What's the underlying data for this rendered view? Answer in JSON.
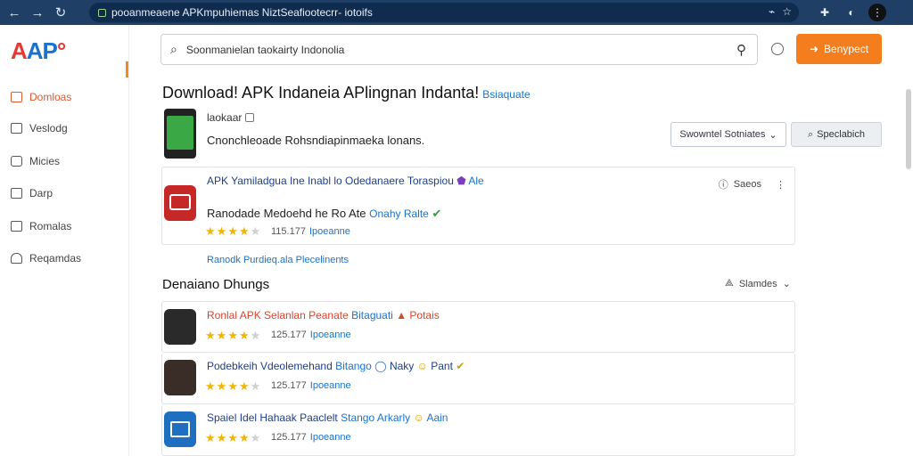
{
  "browser": {
    "url": "pooanmeaene APKmpuhiemas NiztSeafiootecrr- iotoifs"
  },
  "logo": {
    "part1": "A",
    "part2": "AP",
    "mark": "°"
  },
  "sidebar": {
    "items": [
      {
        "label": "Domloas",
        "active": true,
        "icon": "download-icon"
      },
      {
        "label": "Veslodg",
        "active": false,
        "icon": "square-icon"
      },
      {
        "label": "Micies",
        "active": false,
        "icon": "info-icon"
      },
      {
        "label": "Darp",
        "active": false,
        "icon": "box-icon"
      },
      {
        "label": "Romalas",
        "active": false,
        "icon": "grid-icon"
      },
      {
        "label": "Reqamdas",
        "active": false,
        "icon": "home-icon"
      }
    ]
  },
  "search": {
    "placeholder": "Soonmanielan taokairty Indonolia"
  },
  "header_button": {
    "label": "Benypect"
  },
  "page": {
    "title": "Download! APK Indaneia APlingnan Indanta!",
    "subtitle": "Bsiaquate",
    "meta_small": "laokaar",
    "meta_desc": "Cnonchleoade Rohsndiapinmaeka lonans.",
    "dropdown_label": "Swowntel Sotniates",
    "spec_button": "Speclabich"
  },
  "featured": {
    "title": "APK Yamiladgua Ine Inabl lo Odedanaere Toraspiou",
    "title_badge": "Ale",
    "subtitle": "Ranodade Medoehd he Ro Ate",
    "subtitle_badge": "Onahy Ralte",
    "rating": 4,
    "count": "115.177",
    "tag": "Ipoeanne",
    "right_label": "Saeos"
  },
  "link_line": "Ranodk Purdieq.ala Plecelinents",
  "section": {
    "title": "Denaiano Dhungs",
    "right_label": "Slamdes"
  },
  "list": [
    {
      "title": "Ronlal APK Selanlan Peanate",
      "badge": "Bitaguati",
      "badge2": "Potais",
      "title_color": "#d9452f",
      "rating": 4,
      "count": "125.177",
      "tag": "Ipoeanne",
      "icon_color": "#2a2a2a"
    },
    {
      "title": "Podebkeih Vdeolemehand",
      "badge": "Bitango",
      "badge2": "Naky",
      "badge3": "Pant",
      "title_color": "#1d3f8a",
      "rating": 4,
      "count": "125.177",
      "tag": "Ipoeanne",
      "icon_color": "#3a2d28"
    },
    {
      "title": "Spaiel Idel Hahaak Paaclelt",
      "badge": "Stango Arkarly",
      "badge2": "Aain",
      "title_color": "#1d3f8a",
      "rating": 4,
      "count": "125.177",
      "tag": "Ipoeanne",
      "icon_color": "#1e6fc0"
    }
  ]
}
